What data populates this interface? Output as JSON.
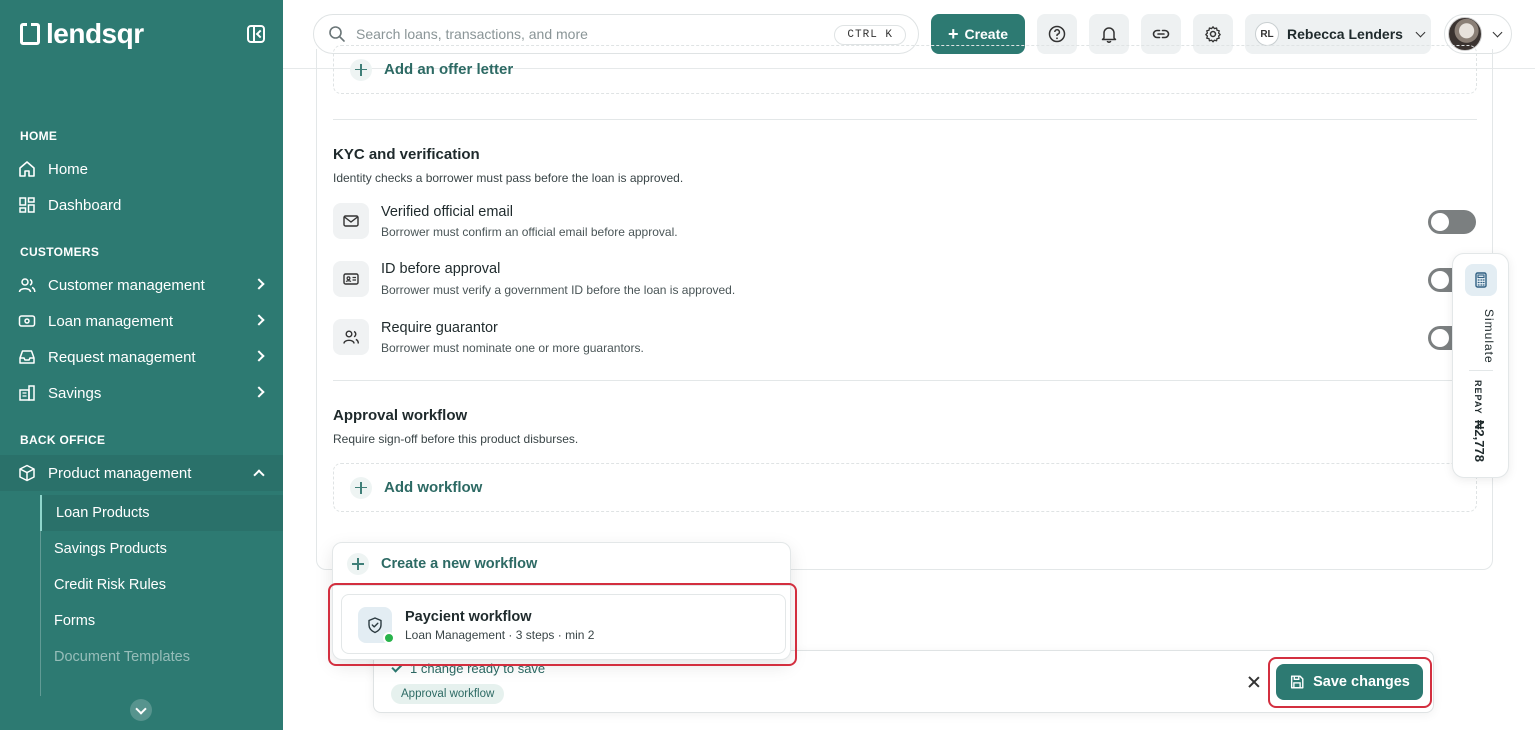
{
  "app": {
    "logo_text": "lendsqr"
  },
  "sidebar": {
    "sections": {
      "home": "HOME",
      "customers": "CUSTOMERS",
      "back_office": "BACK OFFICE"
    },
    "items": {
      "home": "Home",
      "dashboard": "Dashboard",
      "customer_management": "Customer management",
      "loan_management": "Loan management",
      "request_management": "Request management",
      "savings": "Savings",
      "product_management": "Product management"
    },
    "sub_items": [
      "Loan Products",
      "Savings Products",
      "Credit Risk Rules",
      "Forms",
      "Document Templates"
    ]
  },
  "topbar": {
    "search_placeholder": "Search loans, transactions, and more",
    "shortcut": "CTRL K",
    "create_label": "Create",
    "user_initials": "RL",
    "user_name": "Rebecca Lenders"
  },
  "offer_letter": {
    "add_label": "Add an offer letter"
  },
  "kyc": {
    "title": "KYC and verification",
    "subtitle": "Identity checks a borrower must pass before the loan is approved.",
    "rows": [
      {
        "title": "Verified official email",
        "desc": "Borrower must confirm an official email before approval.",
        "icon": "mail-icon",
        "enabled": false
      },
      {
        "title": "ID before approval",
        "desc": "Borrower must verify a government ID before the loan is approved.",
        "icon": "id-card-icon",
        "enabled": false
      },
      {
        "title": "Require guarantor",
        "desc": "Borrower must nominate one or more guarantors.",
        "icon": "users-icon",
        "enabled": false
      }
    ]
  },
  "approval": {
    "title": "Approval workflow",
    "subtitle": "Require sign-off before this product disburses.",
    "add_label": "Add workflow"
  },
  "dropdown": {
    "create_label": "Create a new workflow",
    "item_title": "Paycient workflow",
    "item_sub": "Loan Management · 3 steps · min 2"
  },
  "simulate": {
    "label": "Simulate",
    "repay_label": "REPAY",
    "amount": "₦2,778"
  },
  "savebar": {
    "status": "1 change ready to save",
    "chip": "Approval workflow",
    "save_label": "Save changes"
  },
  "colors": {
    "brand": "#2d7a72",
    "highlight": "#d32f3f",
    "status_dot": "#28b34b"
  }
}
